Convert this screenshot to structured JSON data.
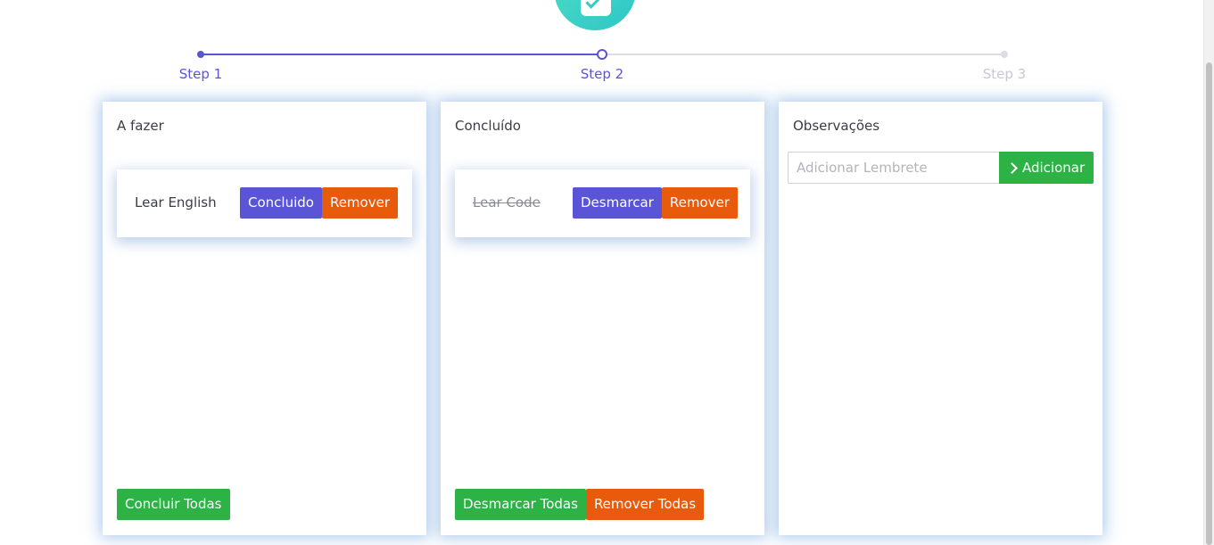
{
  "stepper": {
    "steps": [
      {
        "label": "Step 1",
        "state": "done"
      },
      {
        "label": "Step 2",
        "state": "current"
      },
      {
        "label": "Step 3",
        "state": "pending"
      }
    ]
  },
  "logo": {
    "icon": "app-logo-icon",
    "color": "#37cbc5"
  },
  "todo": {
    "title": "A fazer",
    "tasks": [
      {
        "text": "Lear English",
        "complete_label": "Concluido",
        "remove_label": "Remover"
      }
    ],
    "complete_all_label": "Concluir Todas"
  },
  "done": {
    "title": "Concluído",
    "tasks": [
      {
        "text": "Lear Code",
        "unmark_label": "Desmarcar",
        "remove_label": "Remover"
      }
    ],
    "unmark_all_label": "Desmarcar Todas",
    "remove_all_label": "Remover Todas"
  },
  "notes": {
    "title": "Observações",
    "input_placeholder": "Adicionar Lembrete",
    "input_value": "",
    "add_label": "Adicionar",
    "add_icon": "chevron-right-icon"
  },
  "colors": {
    "primary": "#5a55d6",
    "danger": "#e85a0c",
    "success": "#2db246",
    "pending": "#c8c8d0"
  }
}
